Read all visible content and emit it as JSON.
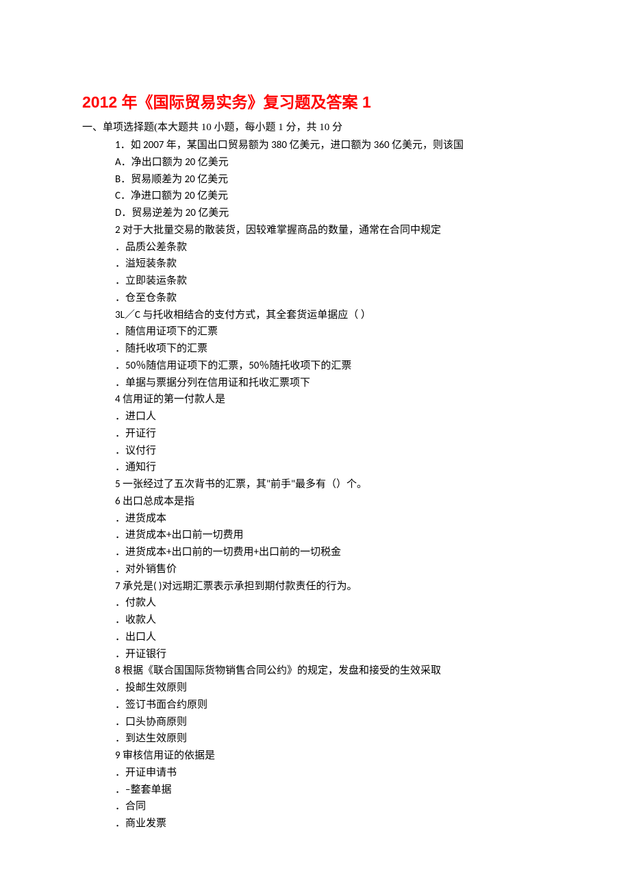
{
  "title": "2012 年《国际贸易实务》复习题及答案 1",
  "section1": {
    "header": "一、单项选择题(本大题共 10 小题，每小题 1 分，共 10 分",
    "q1": {
      "stem": "1．如 2007 年，某国出口贸易额为 380 亿美元，进口额为 360 亿美元，则该国",
      "a": "A．净出口额为 20 亿美元",
      "b": "B．贸易顺差为 20 亿美元",
      "c": "C．净进口额为 20 亿美元",
      "d": "D．贸易逆差为 20 亿美元"
    },
    "q2": {
      "stem": "2 对于大批量交易的散装货，因较难掌握商品的数量，通常在合同中规定",
      "a": "．品质公差条款",
      "b": "．溢短装条款",
      "c": "．立即装运条款",
      "d": "．仓至仓条款"
    },
    "q3": {
      "stem": "3L／C 与托收相结合的支付方式，其全套货运单据应（ ）",
      "a": "．随信用证项下的汇票",
      "b": "．随托收项下的汇票",
      "c": "．50％随信用证项下的汇票，50％随托收项下的汇票",
      "d": "．单据与票据分列在信用证和托收汇票项下"
    },
    "q4": {
      "stem": "4 信用证的第一付款人是",
      "a": "．进口人",
      "b": "．开证行",
      "c": "．议付行",
      "d": "．通知行"
    },
    "q5": {
      "stem": "5 一张经过了五次背书的汇票，其\"前手\"最多有（）个。"
    },
    "q6": {
      "stem": "6 出口总成本是指",
      "a": "．进货成本",
      "b": "．进货成本+出口前一切费用",
      "c": "．进货成本+出口前的一切费用+出口前的一切税金",
      "d": "．对外销售价"
    },
    "q7": {
      "stem": "7 承兑是( )对远期汇票表示承担到期付款责任的行为。",
      "a": "．付款人",
      "b": "．收款人",
      "c": "．出口人",
      "d": "．开证银行"
    },
    "q8": {
      "stem": "8 根据《联合国国际货物销售合同公约》的规定，发盘和接受的生效采取",
      "a": "．投邮生效原则",
      "b": "．签订书面合约原则",
      "c": "．口头协商原则",
      "d": "．到达生效原则"
    },
    "q9": {
      "stem": "9 审核信用证的依据是",
      "a": "．开证申请书",
      "b": "．–整套单据",
      "c": "．合同",
      "d": "．商业发票"
    }
  }
}
